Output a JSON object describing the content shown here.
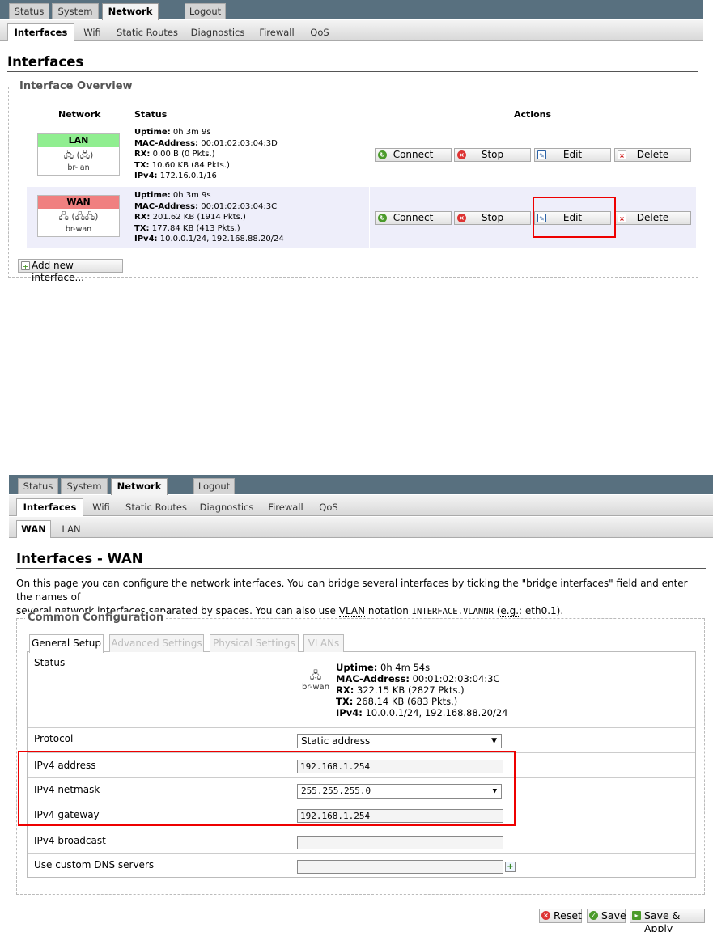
{
  "menu": {
    "tabs": [
      "Status",
      "System",
      "Network",
      "Logout"
    ]
  },
  "submenu": {
    "tabs": [
      "Interfaces",
      "Wifi",
      "Static Routes",
      "Diagnostics",
      "Firewall",
      "QoS"
    ]
  },
  "overview": {
    "title": "Interfaces",
    "legend": "Interface Overview",
    "headers": {
      "network": "Network",
      "status": "Status",
      "actions": "Actions"
    },
    "labels": {
      "uptime": "Uptime:",
      "mac": "MAC-Address:",
      "rx": "RX:",
      "tx": "TX:",
      "ipv4": "IPv4:"
    },
    "rows": [
      {
        "name": "LAN",
        "icon_text": "(",
        "icon_text_end": ")",
        "device": "br-lan",
        "uptime": "0h 3m 9s",
        "mac": "00:01:02:03:04:3D",
        "rx": "0.00 B (0 Pkts.)",
        "tx": "10.60 KB (84 Pkts.)",
        "ipv4": "172.16.0.1/16",
        "color": "#90ee90"
      },
      {
        "name": "WAN",
        "icon_text": "(",
        "icon_text_end": ")",
        "device": "br-wan",
        "uptime": "0h 3m 9s",
        "mac": "00:01:02:03:04:3C",
        "rx": "201.62 KB (1914 Pkts.)",
        "tx": "177.84 KB (413 Pkts.)",
        "ipv4": "10.0.0.1/24, 192.168.88.20/24",
        "color": "#f08080"
      }
    ],
    "buttons": {
      "connect": "Connect",
      "stop": "Stop",
      "edit": "Edit",
      "delete": "Delete"
    },
    "add_button": "Add new interface..."
  },
  "wan": {
    "subtabs": [
      "WAN",
      "LAN"
    ],
    "title": "Interfaces - WAN",
    "description_1": "On this page you can configure the network interfaces. You can bridge several interfaces by ticking the \"bridge interfaces\" field and enter the names of",
    "description_2a": "several network interfaces separated by spaces. You can also use ",
    "description_vlan": "VLAN",
    "description_2b": " notation ",
    "description_code": "INTERFACE.VLANNR",
    "description_2c": " (",
    "description_eg": "e.g.",
    "description_2d": ": eth0.1).",
    "legend": "Common Configuration",
    "config_tabs": [
      "General Setup",
      "Advanced Settings",
      "Physical Settings",
      "VLANs"
    ],
    "status_label": "Status",
    "status": {
      "device": "br-wan",
      "uptime": "0h 4m 54s",
      "mac": "00:01:02:03:04:3C",
      "rx": "322.15 KB (2827 Pkts.)",
      "tx": "268.14 KB (683 Pkts.)",
      "ipv4": "10.0.0.1/24, 192.168.88.20/24"
    },
    "fields": {
      "protocol": {
        "label": "Protocol",
        "value": "Static address"
      },
      "ipv4_address": {
        "label": "IPv4 address",
        "value": "192.168.1.254"
      },
      "ipv4_netmask": {
        "label": "IPv4 netmask",
        "value": "255.255.255.0"
      },
      "ipv4_gateway": {
        "label": "IPv4 gateway",
        "value": "192.168.1.254"
      },
      "ipv4_broadcast": {
        "label": "IPv4 broadcast",
        "value": ""
      },
      "dns": {
        "label": "Use custom DNS servers",
        "value": ""
      }
    },
    "footer": {
      "reset": "Reset",
      "save": "Save",
      "save_apply": "Save & Apply"
    }
  }
}
